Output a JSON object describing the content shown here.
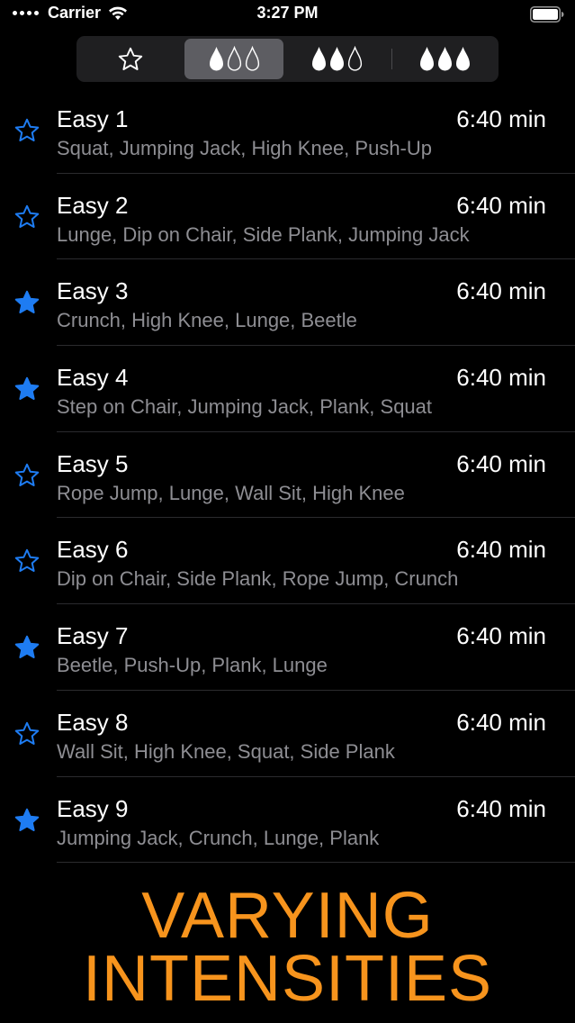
{
  "status_bar": {
    "carrier": "Carrier",
    "time": "3:27 PM"
  },
  "segmented_control": {
    "selected_index": 1,
    "segments": [
      {
        "icon": "star-outline-icon"
      },
      {
        "icon": "one-drop-intensity-icon",
        "filled_drops": 1
      },
      {
        "icon": "two-drop-intensity-icon",
        "filled_drops": 2
      },
      {
        "icon": "three-drop-intensity-icon",
        "filled_drops": 3
      }
    ]
  },
  "colors": {
    "accent_blue": "#1e7cf2",
    "banner_orange": "#f7941d",
    "subtitle_gray": "#8e8e93"
  },
  "workouts": [
    {
      "title": "Easy 1",
      "duration": "6:40 min",
      "exercises": "Squat, Jumping Jack, High Knee, Push-Up",
      "favorite": false
    },
    {
      "title": "Easy 2",
      "duration": "6:40 min",
      "exercises": "Lunge, Dip on Chair, Side Plank, Jumping Jack",
      "favorite": false
    },
    {
      "title": "Easy 3",
      "duration": "6:40 min",
      "exercises": "Crunch, High Knee, Lunge, Beetle",
      "favorite": true
    },
    {
      "title": "Easy 4",
      "duration": "6:40 min",
      "exercises": "Step on Chair, Jumping Jack, Plank, Squat",
      "favorite": true
    },
    {
      "title": "Easy 5",
      "duration": "6:40 min",
      "exercises": "Rope Jump, Lunge, Wall Sit, High Knee",
      "favorite": false
    },
    {
      "title": "Easy 6",
      "duration": "6:40 min",
      "exercises": "Dip on Chair, Side Plank, Rope Jump, Crunch",
      "favorite": false
    },
    {
      "title": "Easy 7",
      "duration": "6:40 min",
      "exercises": "Beetle, Push-Up, Plank, Lunge",
      "favorite": true
    },
    {
      "title": "Easy 8",
      "duration": "6:40 min",
      "exercises": "Wall Sit, High Knee, Squat, Side Plank",
      "favorite": false
    },
    {
      "title": "Easy 9",
      "duration": "6:40 min",
      "exercises": "Jumping Jack, Crunch, Lunge, Plank",
      "favorite": true
    }
  ],
  "banner": {
    "line1": "VARYING",
    "line2": "INTENSITIES"
  }
}
